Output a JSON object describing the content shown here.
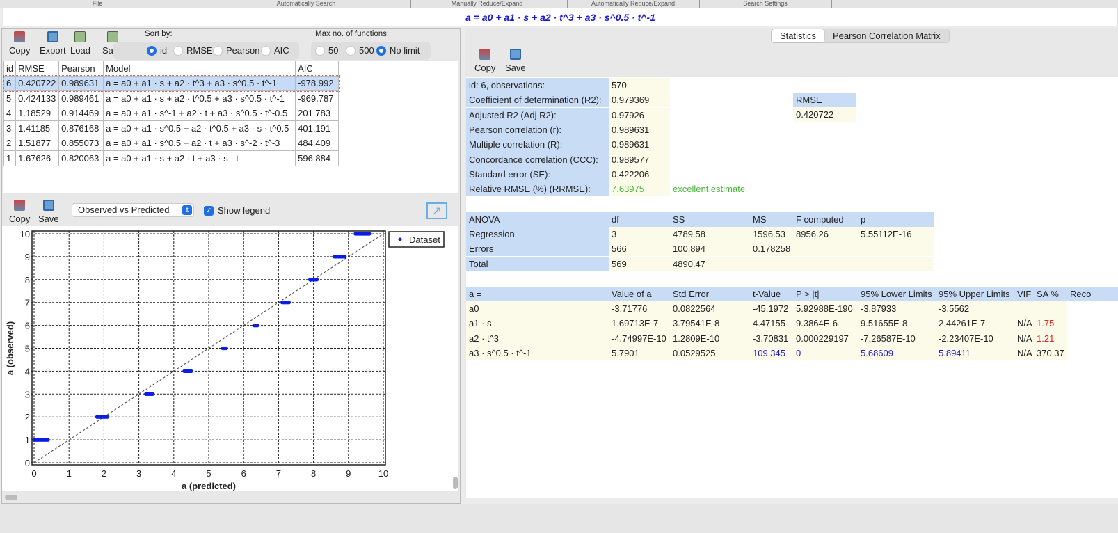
{
  "menu": [
    "File",
    "Automatically Search",
    "Manually Reduce/Expand",
    "Automatically Reduce/Expand",
    "Search Settings"
  ],
  "formula": "a = a0  + a1 · s + a2 · t^3 + a3 · s^0.5 · t^-1",
  "left_toolbar": {
    "copy": "Copy",
    "export": "Export",
    "load": "Load",
    "save": "Save",
    "sort_label": "Sort by:",
    "sort_options": [
      "id",
      "RMSE",
      "Pearson",
      "AIC"
    ],
    "sort_selected": "id",
    "max_label": "Max no. of functions:",
    "max_options": [
      "50",
      "500",
      "No limit"
    ],
    "max_selected": "No limit"
  },
  "models": {
    "headers": [
      "id",
      "RMSE",
      "Pearson",
      "Model",
      "AIC"
    ],
    "rows": [
      [
        "6",
        "0.420722",
        "0.989631",
        "a = a0  + a1 · s + a2 · t^3 + a3 · s^0.5 · t^-1",
        "-978.992"
      ],
      [
        "5",
        "0.424133",
        "0.989461",
        "a = a0  + a1 · s + a2 · t^0.5 + a3 · s^0.5 · t^-1",
        "-969.787"
      ],
      [
        "4",
        "1.18529",
        "0.914469",
        "a = a0  + a1 · s^-1 + a2 · t + a3 · s^0.5 · t^-0.5",
        "201.783"
      ],
      [
        "3",
        "1.41185",
        "0.876168",
        "a = a0  + a1 · s^0.5 + a2 · t^0.5 + a3 · s · t^0.5",
        "401.191"
      ],
      [
        "2",
        "1.51877",
        "0.855073",
        "a = a0  + a1 · s^0.5 + a2 · t + a3 · s^-2 · t^-3",
        "484.409"
      ],
      [
        "1",
        "1.67626",
        "0.820063",
        "a = a0  + a1 · s + a2 · t + a3 · s · t",
        "596.884"
      ]
    ]
  },
  "chart_toolbar": {
    "copy": "Copy",
    "save": "Save",
    "plot_type": "Observed vs Predicted",
    "show_legend": "Show legend",
    "show_legend_checked": true
  },
  "chart_data": {
    "type": "scatter",
    "xlabel": "a (predicted)",
    "ylabel": "a (observed)",
    "xlim": [
      0,
      10
    ],
    "ylim": [
      0,
      10
    ],
    "xticks": [
      "0",
      "1",
      "2",
      "3",
      "4",
      "5",
      "6",
      "7",
      "8",
      "9",
      "10"
    ],
    "yticks": [
      "0",
      "1",
      "2",
      "3",
      "4",
      "5",
      "6",
      "7",
      "8",
      "9",
      "10"
    ],
    "grid": true,
    "legend": "top-right",
    "color": "#0a1ee6",
    "reference_line": "y = x",
    "series": [
      {
        "name": "Dataset",
        "clusters": [
          {
            "observed": 1,
            "predicted_min": 0.0,
            "predicted_max": 0.4
          },
          {
            "observed": 2,
            "predicted_min": 1.8,
            "predicted_max": 2.1
          },
          {
            "observed": 3,
            "predicted_min": 3.2,
            "predicted_max": 3.4
          },
          {
            "observed": 4,
            "predicted_min": 4.3,
            "predicted_max": 4.5
          },
          {
            "observed": 5,
            "predicted_min": 5.4,
            "predicted_max": 5.5
          },
          {
            "observed": 6,
            "predicted_min": 6.3,
            "predicted_max": 6.4
          },
          {
            "observed": 7,
            "predicted_min": 7.1,
            "predicted_max": 7.3
          },
          {
            "observed": 8,
            "predicted_min": 7.9,
            "predicted_max": 8.1
          },
          {
            "observed": 9,
            "predicted_min": 8.6,
            "predicted_max": 8.9
          },
          {
            "observed": 10,
            "predicted_min": 9.2,
            "predicted_max": 9.6
          }
        ]
      }
    ]
  },
  "right_tabs": [
    "Statistics",
    "Pearson Correlation Matrix"
  ],
  "right_toolbar": {
    "copy": "Copy",
    "save": "Save"
  },
  "stats": [
    [
      "id: 6, observations:",
      "570"
    ],
    [
      "Coefficient of determination (R2):",
      "0.979369"
    ],
    [
      "Adjusted R2 (Adj R2):",
      "0.97926"
    ],
    [
      "Pearson correlation (r):",
      "0.989631"
    ],
    [
      "Multiple correlation (R):",
      "0.989631"
    ],
    [
      "Concordance correlation (CCC):",
      "0.989577"
    ],
    [
      "Standard error (SE):",
      "0.422206"
    ],
    [
      "Relative RMSE (%) (RRMSE):",
      "7.63975"
    ]
  ],
  "rrmse_note": "excellent estimate",
  "rmse": {
    "label": "RMSE",
    "value": "0.420722"
  },
  "anova": {
    "headers": [
      "ANOVA",
      "df",
      "SS",
      "MS",
      "F computed",
      "p"
    ],
    "rows": [
      [
        "Regression",
        "3",
        "4789.58",
        "1596.53",
        "8956.26",
        "5.55112E-16"
      ],
      [
        "Errors",
        "566",
        "100.894",
        "0.178258",
        "",
        ""
      ],
      [
        "Total",
        "569",
        "4890.47",
        "",
        "",
        ""
      ]
    ]
  },
  "coef": {
    "headers": [
      "a =",
      "Value of a",
      "Std Error",
      "t-Value",
      "P > |t|",
      "95% Lower Limits",
      "95% Upper Limits",
      "VIF",
      "SA %",
      "Reco"
    ],
    "rows": [
      [
        "a0",
        "-3.71776",
        "0.0822564",
        "-45.1972",
        "5.92988E-190",
        "-3.87933",
        "-3.5562",
        "",
        ""
      ],
      [
        "a1 · s",
        "1.69713E-7",
        "3.79541E-8",
        "4.47155",
        "9.3864E-6",
        "9.51655E-8",
        "2.44261E-7",
        "N/A",
        "1.75"
      ],
      [
        "a2 · t^3",
        "-4.74997E-10",
        "1.2809E-10",
        "-3.70831",
        "0.000229197",
        "-7.26587E-10",
        "-2.23407E-10",
        "N/A",
        "1.21"
      ],
      [
        "a3 · s^0.5 · t^-1",
        "5.7901",
        "0.0529525",
        "109.345",
        "0",
        "5.68609",
        "5.89411",
        "N/A",
        "370.37"
      ]
    ]
  },
  "colors": {
    "highlight_blue": "#1a1acc",
    "good_green": "#4bb43c",
    "warn_red": "#e0231c",
    "header_blue": "#c9dcf6",
    "cell_yellow": "#fcfbe9"
  }
}
